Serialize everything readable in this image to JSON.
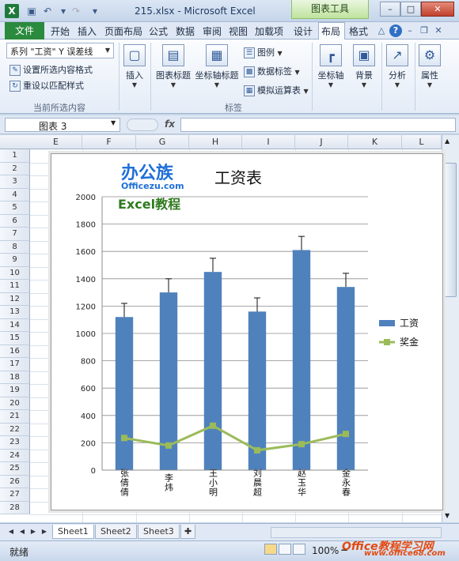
{
  "window": {
    "title": "215.xlsx - Microsoft Excel",
    "tools_tab": "图表工具",
    "app_icon": "X"
  },
  "ribbon_tabs": {
    "file": "文件",
    "tabs": [
      "开始",
      "插入",
      "页面布局",
      "公式",
      "数据",
      "审阅",
      "视图",
      "加载项",
      "设计",
      "布局",
      "格式"
    ]
  },
  "ribbon": {
    "selection_dropdown": "系列 \"工资\" Y 误差线",
    "format_selection": "设置所选内容格式",
    "reset_style": "重设以匹配样式",
    "group_current": "当前所选内容",
    "insert": "插入",
    "chart_title": "图表标题",
    "axis_titles": "坐标轴标题",
    "legend": "图例",
    "data_labels": "数据标签",
    "data_table": "模拟运算表",
    "group_labels": "标签",
    "axes": "坐标轴",
    "background": "背景",
    "analysis": "分析",
    "properties": "属性"
  },
  "formula_bar": {
    "name_box": "图表 3",
    "fx": "fx"
  },
  "columns": [
    "E",
    "F",
    "G",
    "H",
    "I",
    "J",
    "K",
    "L"
  ],
  "rows": [
    "1",
    "2",
    "3",
    "4",
    "5",
    "6",
    "7",
    "8",
    "9",
    "10",
    "11",
    "12",
    "13",
    "14",
    "15",
    "16",
    "17",
    "18",
    "19",
    "20",
    "21",
    "22",
    "23",
    "24",
    "25",
    "26",
    "27",
    "28"
  ],
  "chart_overlay": {
    "logo": "办公族",
    "logo_sub": "Officezu.com",
    "excel_tutorial": "Excel教程"
  },
  "chart_data": {
    "type": "bar",
    "title": "工资表",
    "categories": [
      "张倩倩",
      "李炜",
      "王小明",
      "刘晨超",
      "赵玉华",
      "金永春"
    ],
    "series": [
      {
        "name": "工资",
        "type": "bar",
        "values": [
          1120,
          1300,
          1450,
          1160,
          1610,
          1340
        ],
        "error_plus": [
          100,
          100,
          100,
          100,
          100,
          100
        ],
        "color": "#4f81bd"
      },
      {
        "name": "奖金",
        "type": "line",
        "values": [
          235,
          180,
          325,
          145,
          190,
          265
        ],
        "color": "#9bbb59"
      }
    ],
    "y_ticks": [
      "0",
      "200",
      "400",
      "600",
      "800",
      "1000",
      "1200",
      "1400",
      "1600",
      "1800",
      "2000"
    ],
    "ylim": [
      0,
      2000
    ],
    "grid": true,
    "legend_position": "right"
  },
  "sheet_tabs": [
    "Sheet1",
    "Sheet2",
    "Sheet3"
  ],
  "status": {
    "ready": "就绪",
    "zoom": "100%"
  },
  "watermark": {
    "line1": "Office教程学习网",
    "line2": "www.office68.com"
  }
}
